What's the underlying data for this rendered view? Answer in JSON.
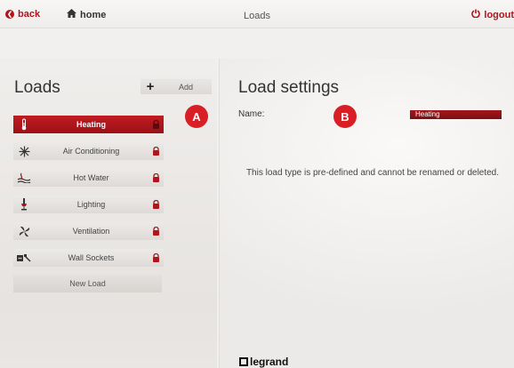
{
  "topbar": {
    "back_label": "back",
    "home_label": "home",
    "title": "Loads",
    "logout_label": "logout"
  },
  "loads_panel": {
    "heading": "Loads",
    "add_label": "Add",
    "items": [
      {
        "label": "Heating",
        "icon": "thermometer-icon",
        "locked": true,
        "active": true
      },
      {
        "label": "Air Conditioning",
        "icon": "snowflake-icon",
        "locked": true
      },
      {
        "label": "Hot Water",
        "icon": "hot-water-icon",
        "locked": true
      },
      {
        "label": "Lighting",
        "icon": "lamp-icon",
        "locked": true
      },
      {
        "label": "Ventilation",
        "icon": "fan-icon",
        "locked": true
      },
      {
        "label": "Wall Sockets",
        "icon": "plug-icon",
        "locked": true
      }
    ],
    "new_load_label": "New Load"
  },
  "settings_panel": {
    "heading": "Load settings",
    "name_label": "Name:",
    "name_value": "Heating",
    "message": "This load type is pre-defined and cannot be renamed or deleted."
  },
  "callouts": [
    "A",
    "B"
  ],
  "brand": "legrand",
  "colors": {
    "accent": "#b0141c",
    "active_item": "#a8161b",
    "callout": "#d81f26",
    "background": "#f2f0ee"
  }
}
